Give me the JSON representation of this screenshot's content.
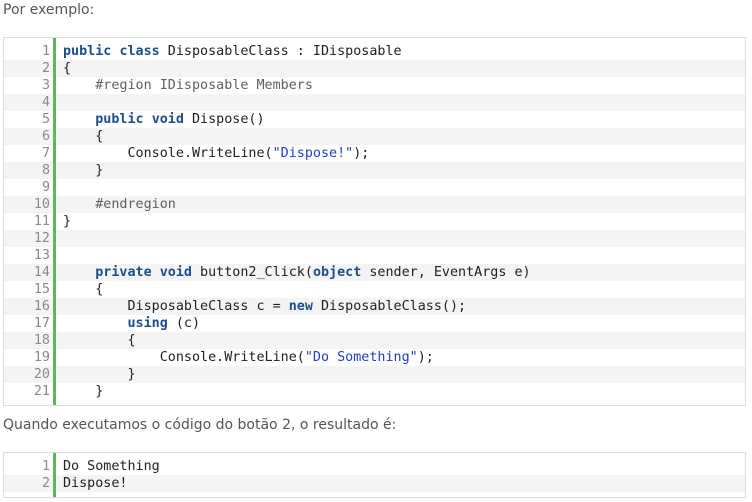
{
  "intro_text": "Por exemplo:",
  "result_text": "Quando executamos o código do botão 2, o resultado é:",
  "accent_color": "#5cb85c",
  "code_block_1": {
    "lines": [
      {
        "n": "1",
        "t": [
          [
            "kw",
            "public"
          ],
          [
            "p",
            " "
          ],
          [
            "kw",
            "class"
          ],
          [
            "p",
            " DisposableClass : IDisposable"
          ]
        ]
      },
      {
        "n": "2",
        "t": [
          [
            "p",
            "{"
          ]
        ]
      },
      {
        "n": "3",
        "t": [
          [
            "p",
            "    "
          ],
          [
            "cm",
            "#region IDisposable Members"
          ]
        ]
      },
      {
        "n": "4",
        "t": []
      },
      {
        "n": "5",
        "t": [
          [
            "p",
            "    "
          ],
          [
            "kw",
            "public"
          ],
          [
            "p",
            " "
          ],
          [
            "kw",
            "void"
          ],
          [
            "p",
            " Dispose()"
          ]
        ]
      },
      {
        "n": "6",
        "t": [
          [
            "p",
            "    {"
          ]
        ]
      },
      {
        "n": "7",
        "t": [
          [
            "p",
            "        Console.WriteLine("
          ],
          [
            "str",
            "\"Dispose!\""
          ],
          [
            "p",
            ");"
          ]
        ]
      },
      {
        "n": "8",
        "t": [
          [
            "p",
            "    }"
          ]
        ]
      },
      {
        "n": "9",
        "t": []
      },
      {
        "n": "10",
        "t": [
          [
            "p",
            "    "
          ],
          [
            "cm",
            "#endregion"
          ]
        ]
      },
      {
        "n": "11",
        "t": [
          [
            "p",
            "}"
          ]
        ]
      },
      {
        "n": "12",
        "t": []
      },
      {
        "n": "13",
        "t": []
      },
      {
        "n": "14",
        "t": [
          [
            "p",
            "    "
          ],
          [
            "kw",
            "private"
          ],
          [
            "p",
            " "
          ],
          [
            "kw",
            "void"
          ],
          [
            "p",
            " button2_Click("
          ],
          [
            "kw",
            "object"
          ],
          [
            "p",
            " sender, EventArgs e)"
          ]
        ]
      },
      {
        "n": "15",
        "t": [
          [
            "p",
            "    {"
          ]
        ]
      },
      {
        "n": "16",
        "t": [
          [
            "p",
            "        DisposableClass c = "
          ],
          [
            "kw",
            "new"
          ],
          [
            "p",
            " DisposableClass();"
          ]
        ]
      },
      {
        "n": "17",
        "t": [
          [
            "p",
            "        "
          ],
          [
            "kw",
            "using"
          ],
          [
            "p",
            " (c)"
          ]
        ]
      },
      {
        "n": "18",
        "t": [
          [
            "p",
            "        {"
          ]
        ]
      },
      {
        "n": "19",
        "t": [
          [
            "p",
            "            Console.WriteLine("
          ],
          [
            "str",
            "\"Do Something\""
          ],
          [
            "p",
            ");"
          ]
        ]
      },
      {
        "n": "20",
        "t": [
          [
            "p",
            "        }"
          ]
        ]
      },
      {
        "n": "21",
        "t": [
          [
            "p",
            "    }"
          ]
        ]
      }
    ]
  },
  "code_block_2": {
    "lines": [
      {
        "n": "1",
        "t": [
          [
            "p",
            "Do Something"
          ]
        ]
      },
      {
        "n": "2",
        "t": [
          [
            "p",
            "Dispose!"
          ]
        ]
      }
    ]
  }
}
